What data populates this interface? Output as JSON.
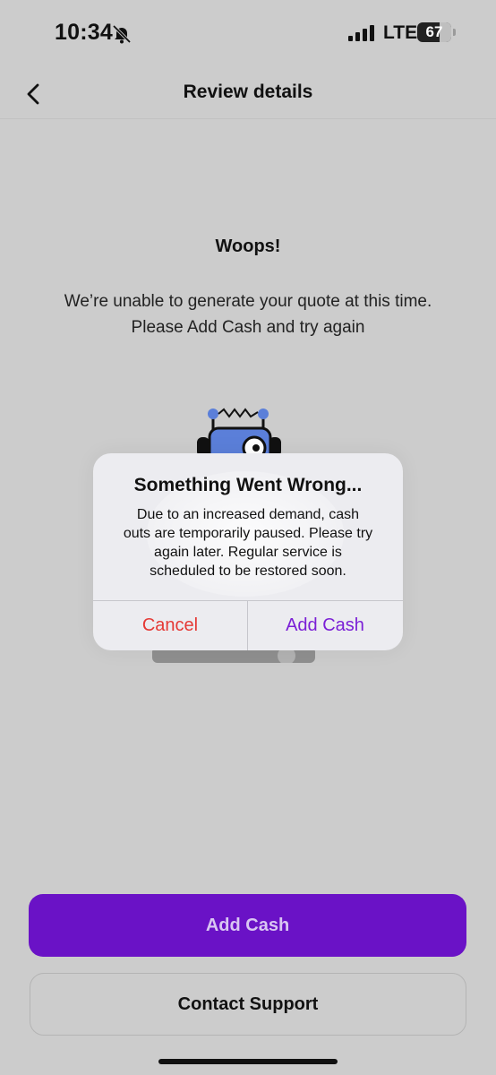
{
  "status_bar": {
    "time": "10:34",
    "network": "LTE",
    "battery_level": "67",
    "battery_fraction": 0.67,
    "icons": [
      "bell-slash-icon",
      "signal-bars-icon",
      "battery-icon"
    ]
  },
  "nav": {
    "title": "Review details",
    "back_icon": "chevron-left-icon"
  },
  "message": {
    "title": "Woops!",
    "line1": "We’re unable to generate your quote at this time.",
    "line2": "Please Add Cash and try again"
  },
  "illustration": {
    "icon": "robot-illustration"
  },
  "alert": {
    "title": "Something Went Wrong...",
    "line1": "Due to an increased demand, cash",
    "line2": "outs are temporarily paused. Please try",
    "line3": "again later. Regular service is",
    "line4": "scheduled to be restored soon.",
    "cancel_label": "Cancel",
    "confirm_label": "Add Cash",
    "cancel_color": "#e53935",
    "confirm_color": "#7b1fd6"
  },
  "actions": {
    "primary_label": "Add Cash",
    "secondary_label": "Contact Support",
    "primary_color": "#6a12c6"
  },
  "colors": {
    "background": "#cccccc",
    "text": "#111111"
  }
}
